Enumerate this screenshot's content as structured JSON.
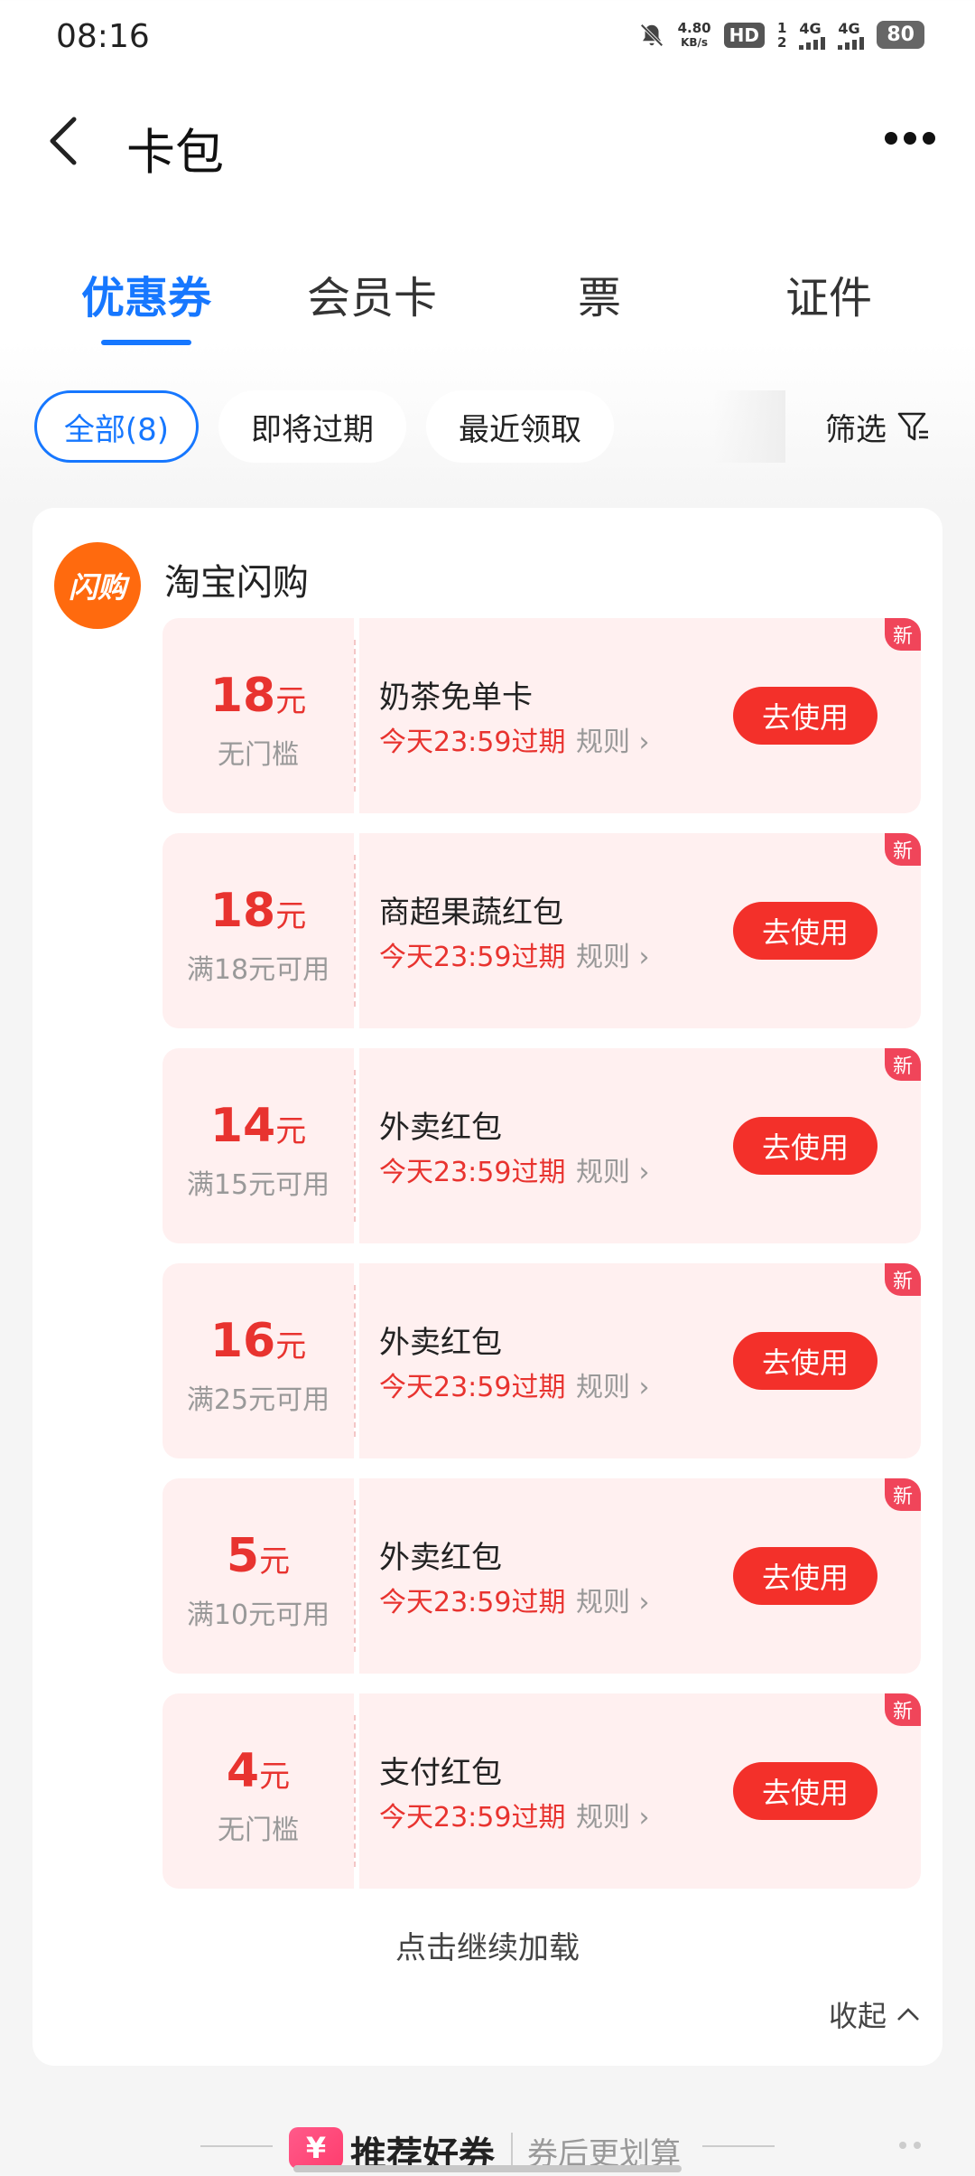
{
  "status_bar": {
    "time": "08:16",
    "net_speed_value": "4.80",
    "net_speed_unit": "KB/s",
    "hd_label": "HD",
    "sim_top": "1",
    "sim_bottom": "2",
    "signal1": "4G",
    "signal2": "4G",
    "battery": "80"
  },
  "header": {
    "title": "卡包",
    "back_icon": "chevron-left-icon",
    "more_icon": "more-dots-icon"
  },
  "tabs": [
    {
      "label": "优惠券",
      "active": true
    },
    {
      "label": "会员卡",
      "active": false
    },
    {
      "label": "票",
      "active": false
    },
    {
      "label": "证件",
      "active": false
    }
  ],
  "filters": {
    "chips": [
      {
        "label": "全部(8)",
        "active": true
      },
      {
        "label": "即将过期",
        "active": false
      },
      {
        "label": "最近领取",
        "active": false
      }
    ],
    "filter_label": "筛选"
  },
  "merchant": {
    "logo_text": "闪购",
    "name": "淘宝闪购",
    "logo_color": "#ff6a0e"
  },
  "coupons": [
    {
      "amount": "18",
      "unit": "元",
      "condition": "无门槛",
      "name": "奶茶免单卡",
      "expiry": "今天23:59过期",
      "rules": "规则",
      "button": "去使用",
      "badge": "新"
    },
    {
      "amount": "18",
      "unit": "元",
      "condition": "满18元可用",
      "name": "商超果蔬红包",
      "expiry": "今天23:59过期",
      "rules": "规则",
      "button": "去使用",
      "badge": "新"
    },
    {
      "amount": "14",
      "unit": "元",
      "condition": "满15元可用",
      "name": "外卖红包",
      "expiry": "今天23:59过期",
      "rules": "规则",
      "button": "去使用",
      "badge": "新"
    },
    {
      "amount": "16",
      "unit": "元",
      "condition": "满25元可用",
      "name": "外卖红包",
      "expiry": "今天23:59过期",
      "rules": "规则",
      "button": "去使用",
      "badge": "新"
    },
    {
      "amount": "5",
      "unit": "元",
      "condition": "满10元可用",
      "name": "外卖红包",
      "expiry": "今天23:59过期",
      "rules": "规则",
      "button": "去使用",
      "badge": "新"
    },
    {
      "amount": "4",
      "unit": "元",
      "condition": "无门槛",
      "name": "支付红包",
      "expiry": "今天23:59过期",
      "rules": "规则",
      "button": "去使用",
      "badge": "新"
    }
  ],
  "load_more": "点击继续加载",
  "collapse": "收起",
  "recommend": {
    "icon_text": "¥",
    "title": "推荐好券",
    "subtitle": "券后更划算"
  },
  "colors": {
    "accent": "#1677ff",
    "coupon_red": "#e8332f",
    "button_red": "#f3302a",
    "coupon_bg": "#fff0f0"
  }
}
